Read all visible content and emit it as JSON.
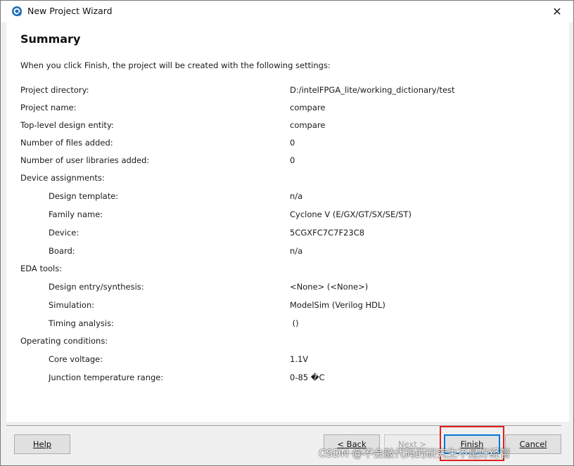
{
  "window": {
    "title": "New Project Wizard",
    "close_glyph": "✕"
  },
  "summary": {
    "heading": "Summary",
    "intro": "When you click Finish, the project will be created with the following settings:",
    "rows": [
      {
        "label": "Project directory:",
        "value": "D:/intelFPGA_lite/working_dictionary/test"
      },
      {
        "label": "Project name:",
        "value": "compare"
      },
      {
        "label": "Top-level design entity:",
        "value": "compare"
      },
      {
        "label": "Number of files added:",
        "value": "0"
      },
      {
        "label": "Number of user libraries added:",
        "value": "0"
      },
      {
        "label": "Device assignments:",
        "value": ""
      },
      {
        "label": "Design template:",
        "value": "n/a"
      },
      {
        "label": "Family name:",
        "value": "Cyclone V (E/GX/GT/SX/SE/ST)"
      },
      {
        "label": "Device:",
        "value": "5CGXFC7C7F23C8"
      },
      {
        "label": "Board:",
        "value": "n/a"
      },
      {
        "label": "EDA tools:",
        "value": ""
      },
      {
        "label": "Design entry/synthesis:",
        "value": "<None> (<None>)"
      },
      {
        "label": "Simulation:",
        "value": "ModelSim (Verilog HDL)"
      },
      {
        "label": "Timing analysis:",
        "value": " ()"
      },
      {
        "label": "Operating conditions:",
        "value": ""
      },
      {
        "label": "Core voltage:",
        "value": "1.1V"
      },
      {
        "label": "Junction temperature range:",
        "value": "0-85 �C"
      }
    ]
  },
  "buttons": {
    "help": "Help",
    "back": "< Back",
    "next": "Next >",
    "finish": "Finish",
    "cancel": "Cancel"
  },
  "watermark": "CSDN @不会敲代码的研究生不是好经管",
  "colors": {
    "accent": "#0078d7",
    "highlight_box": "#e02020"
  }
}
